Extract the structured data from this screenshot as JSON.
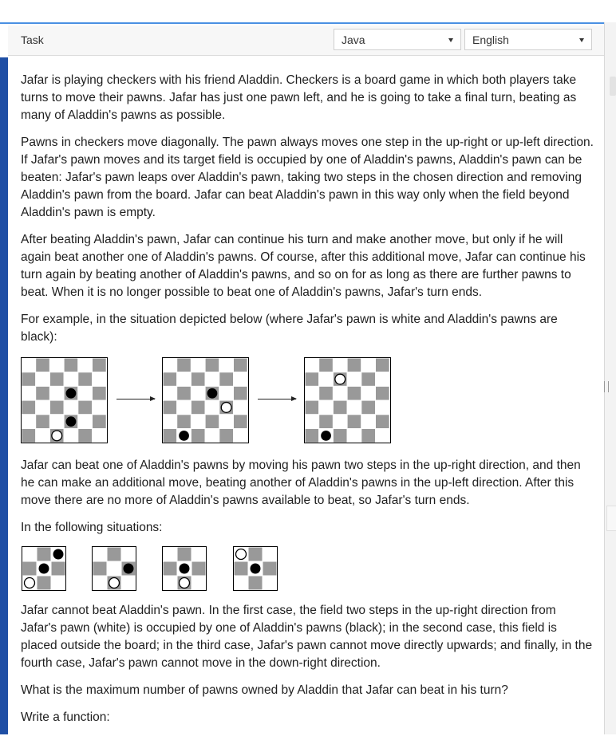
{
  "header": {
    "title": "Task",
    "language_select": {
      "value": "Java"
    },
    "human_language_select": {
      "value": "English"
    }
  },
  "content": {
    "paragraphs": [
      "Jafar is playing checkers with his friend Aladdin. Checkers is a board game in which both players take turns to move their pawns. Jafar has just one pawn left, and he is going to take a final turn, beating as many of Aladdin's pawns as possible.",
      "Pawns in checkers move diagonally. The pawn always moves one step in the up-right or up-left direction. If Jafar's pawn moves and its target field is occupied by one of Aladdin's pawns, Aladdin's pawn can be beaten: Jafar's pawn leaps over Aladdin's pawn, taking two steps in the chosen direction and removing Aladdin's pawn from the board. Jafar can beat Aladdin's pawn in this way only when the field beyond Aladdin's pawn is empty.",
      "After beating Aladdin's pawn, Jafar can continue his turn and make another move, but only if he will again beat another one of Aladdin's pawns. Of course, after this additional move, Jafar can continue his turn again by beating another of Aladdin's pawns, and so on for as long as there are further pawns to beat. When it is no longer possible to beat one of Aladdin's pawns, Jafar's turn ends.",
      "For example, in the situation depicted below (where Jafar's pawn is white and Aladdin's pawns are black):"
    ],
    "after_example": "Jafar can beat one of Aladdin's pawns by moving his pawn two steps in the up-right direction, and then he can make an additional move, beating another of Aladdin's pawns in the up-left direction. After this move there are no more of Aladdin's pawns available to beat, so Jafar's turn ends.",
    "following_intro": "In the following situations:",
    "after_situations": "Jafar cannot beat Aladdin's pawn. In the first case, the field two steps in the up-right direction from Jafar's pawn (white) is occupied by one of Aladdin's pawns (black); in the second case, this field is placed outside the board; in the third case, Jafar's pawn cannot move directly upwards; and finally, in the fourth case, Jafar's pawn cannot move in the down-right direction.",
    "question": "What is the maximum number of pawns owned by Aladdin that Jafar can beat in his turn?",
    "write_function": "Write a function:"
  },
  "colors": {
    "accent_top": "#4a90e2",
    "accent_left": "#1f4fa5",
    "board_dark": "#999999",
    "board_light": "#ffffff"
  },
  "example_boards": [
    {
      "size": 6,
      "black": [
        [
          2,
          3
        ],
        [
          4,
          3
        ]
      ],
      "white": [
        [
          5,
          2
        ]
      ]
    },
    {
      "size": 6,
      "black": [
        [
          2,
          3
        ],
        [
          5,
          1
        ]
      ],
      "white": [
        [
          3,
          4
        ]
      ]
    },
    {
      "size": 6,
      "black": [
        [
          5,
          1
        ]
      ],
      "white": [
        [
          1,
          2
        ]
      ]
    }
  ],
  "situation_boards": [
    {
      "size": 3,
      "black": [
        [
          0,
          2
        ],
        [
          1,
          1
        ]
      ],
      "white": [
        [
          2,
          0
        ]
      ]
    },
    {
      "size": 3,
      "black": [
        [
          1,
          2
        ]
      ],
      "white": [
        [
          2,
          1
        ]
      ]
    },
    {
      "size": 3,
      "black": [
        [
          1,
          1
        ]
      ],
      "white": [
        [
          2,
          1
        ]
      ]
    },
    {
      "size": 3,
      "black": [
        [
          1,
          1
        ]
      ],
      "white": [
        [
          0,
          0
        ]
      ]
    }
  ]
}
